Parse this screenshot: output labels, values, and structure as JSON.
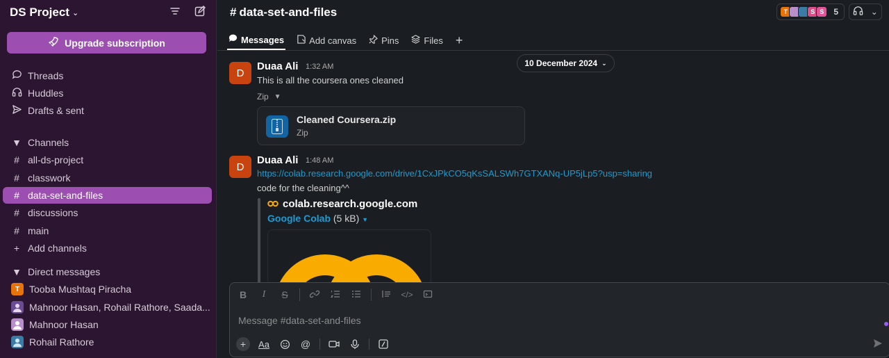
{
  "workspace": {
    "name": "DS Project"
  },
  "upgrade_label": "Upgrade subscription",
  "nav": {
    "threads": "Threads",
    "huddles": "Huddles",
    "drafts": "Drafts & sent"
  },
  "channels_header": "Channels",
  "channels": [
    "all-ds-project",
    "classwork",
    "data-set-and-files",
    "discussions",
    "main"
  ],
  "add_channels": "Add channels",
  "dms_header": "Direct messages",
  "dms": [
    {
      "name": "Tooba Mushtaq Piracha",
      "initial": "T",
      "color": "#e8730a"
    },
    {
      "name": "Mahnoor Hasan, Rohail Rathore, Saada...",
      "initial": "",
      "color": "#6a4c93",
      "badge": "4"
    },
    {
      "name": "Mahnoor Hasan",
      "initial": "",
      "color": "#b88fc9"
    },
    {
      "name": "Rohail Rathore",
      "initial": "",
      "color": "#3a7ca5"
    }
  ],
  "channel": {
    "title": "data-set-and-files",
    "member_count": "5",
    "member_avatars": [
      {
        "initial": "T",
        "color": "#e8730a"
      },
      {
        "initial": "",
        "color": "#b88fc9"
      },
      {
        "initial": "",
        "color": "#3a7ca5"
      },
      {
        "initial": "S",
        "color": "#d94f8a"
      },
      {
        "initial": "S",
        "color": "#e05597"
      }
    ]
  },
  "tabs": [
    "Messages",
    "Add canvas",
    "Pins",
    "Files"
  ],
  "date_divider": "10 December 2024",
  "messages": [
    {
      "author": "Duaa Ali",
      "initial": "D",
      "time": "1:32 AM",
      "text": "This is all the coursera ones cleaned",
      "attachment_label": "Zip",
      "file": {
        "name": "Cleaned Coursera.zip",
        "type": "Zip"
      }
    },
    {
      "author": "Duaa Ali",
      "initial": "D",
      "time": "1:48 AM",
      "link": "https://colab.research.google.com/drive/1CxJPkCO5qKsSALSWh7GTXANq-UP5jLp5?usp=sharing",
      "text": "code for the cleaning^^",
      "unfurl": {
        "site": "colab.research.google.com",
        "title": "Google Colab",
        "size": "(5 kB)"
      }
    }
  ],
  "composer": {
    "placeholder": "Message #data-set-and-files"
  },
  "colors": {
    "sidebar": "#2b1530",
    "accent": "#9c4fb0",
    "link": "#1d9bd1",
    "avatar": "#c8430e"
  }
}
